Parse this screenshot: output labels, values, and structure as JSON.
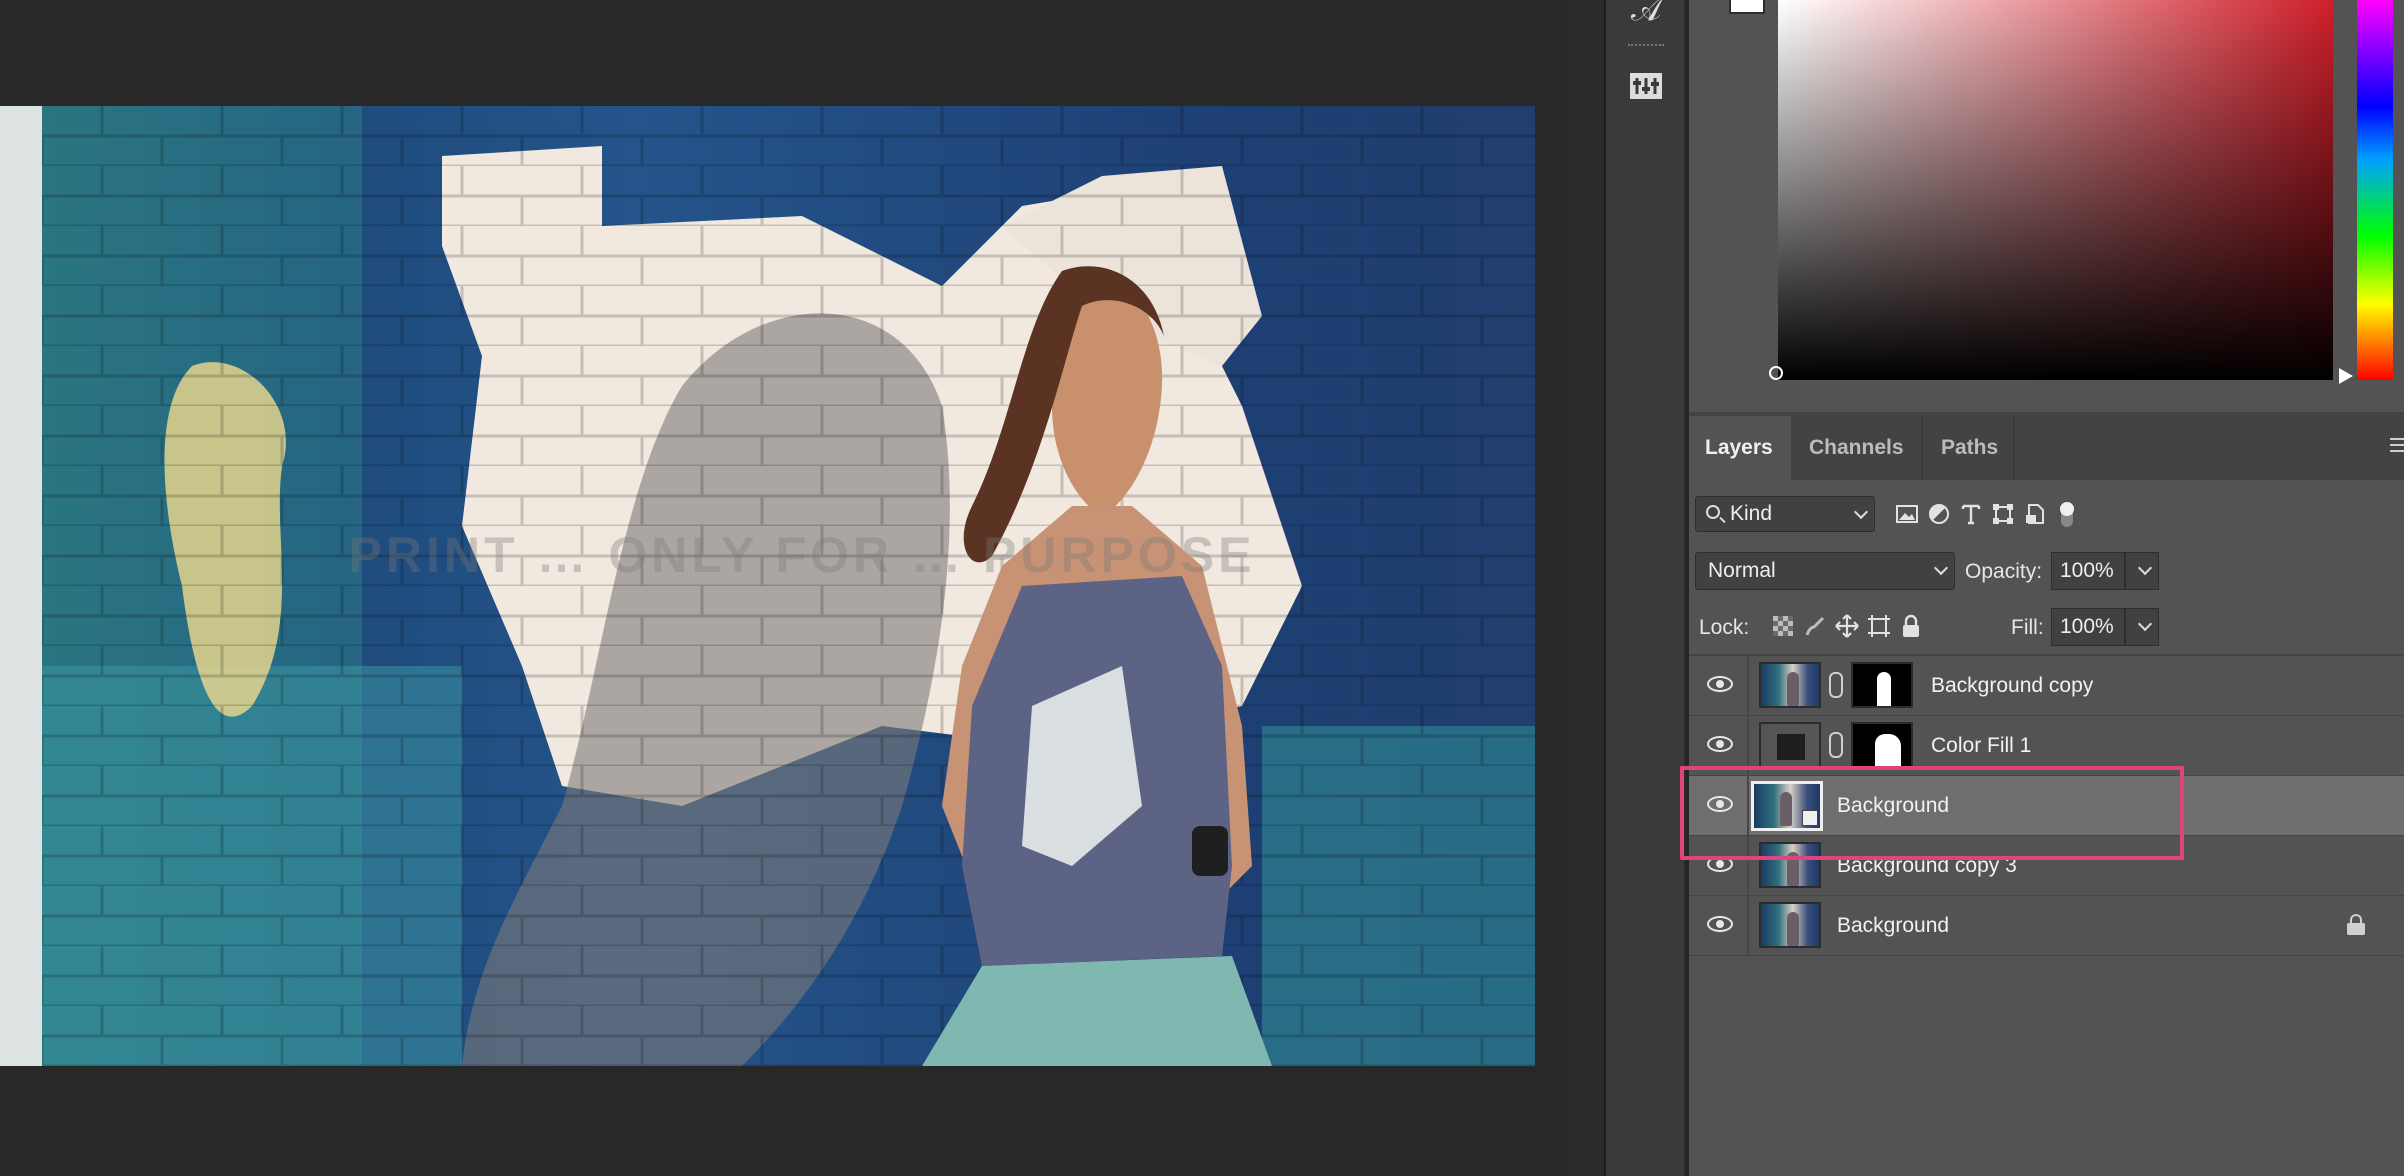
{
  "canvas": {
    "watermark_text": "PRINT … ONLY FOR … PURPOSE"
  },
  "tool_strip": {
    "tools": [
      {
        "icon": "character-icon",
        "glyph": "𝒜"
      },
      {
        "icon": "adjustments-icon",
        "glyph": "⊞"
      }
    ]
  },
  "color_panel": {
    "foreground_color": "#ffffff",
    "hue_color": "#cf1f2a"
  },
  "layers_panel": {
    "tabs": [
      {
        "label": "Layers",
        "active": true
      },
      {
        "label": "Channels",
        "active": false
      },
      {
        "label": "Paths",
        "active": false
      }
    ],
    "filter": {
      "kind_label": "Kind",
      "icons": [
        "image-filter-icon",
        "adjustment-filter-icon",
        "type-filter-icon",
        "shape-filter-icon",
        "smart-object-filter-icon",
        "filter-toggle-icon"
      ]
    },
    "blend_mode": "Normal",
    "opacity_label": "Opacity:",
    "opacity_value": "100%",
    "lock_label": "Lock:",
    "lock_icons": [
      "lock-transparent-pixels-icon",
      "lock-image-pixels-icon",
      "lock-position-icon",
      "lock-artboard-icon",
      "lock-all-icon"
    ],
    "fill_label": "Fill:",
    "fill_value": "100%",
    "layers": [
      {
        "name": "Background copy",
        "visible": true,
        "selected": false,
        "locked": false,
        "has_mask": true
      },
      {
        "name": "Color Fill 1",
        "visible": true,
        "selected": false,
        "locked": false,
        "has_mask": true
      },
      {
        "name": "Background",
        "visible": true,
        "selected": true,
        "locked": false,
        "smart_object": true
      },
      {
        "name": "Background copy 3",
        "visible": true,
        "selected": false,
        "locked": false
      },
      {
        "name": "Background",
        "visible": true,
        "selected": false,
        "locked": true
      }
    ]
  },
  "annotation": {
    "highlight_color": "#e0447e"
  }
}
